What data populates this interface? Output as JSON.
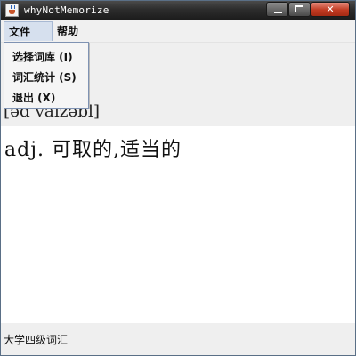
{
  "window": {
    "title": "whyNotMemorize"
  },
  "menubar": {
    "file_label": "文件 (F)",
    "help_label": "帮助 (H)"
  },
  "file_menu": {
    "items": [
      {
        "label": "选择词库 (I)"
      },
      {
        "label": "词汇统计 (S)"
      },
      {
        "label": "退出 (X)"
      }
    ]
  },
  "word": {
    "phonetic": "[əd vaɪzəbl]",
    "meaning": "adj. 可取的,适当的"
  },
  "status": {
    "wordbook": "大学四级词汇"
  },
  "icons": {
    "app": "java-cup-icon",
    "minimize": "minimize-icon",
    "maximize": "maximize-icon",
    "close": "close-icon"
  }
}
